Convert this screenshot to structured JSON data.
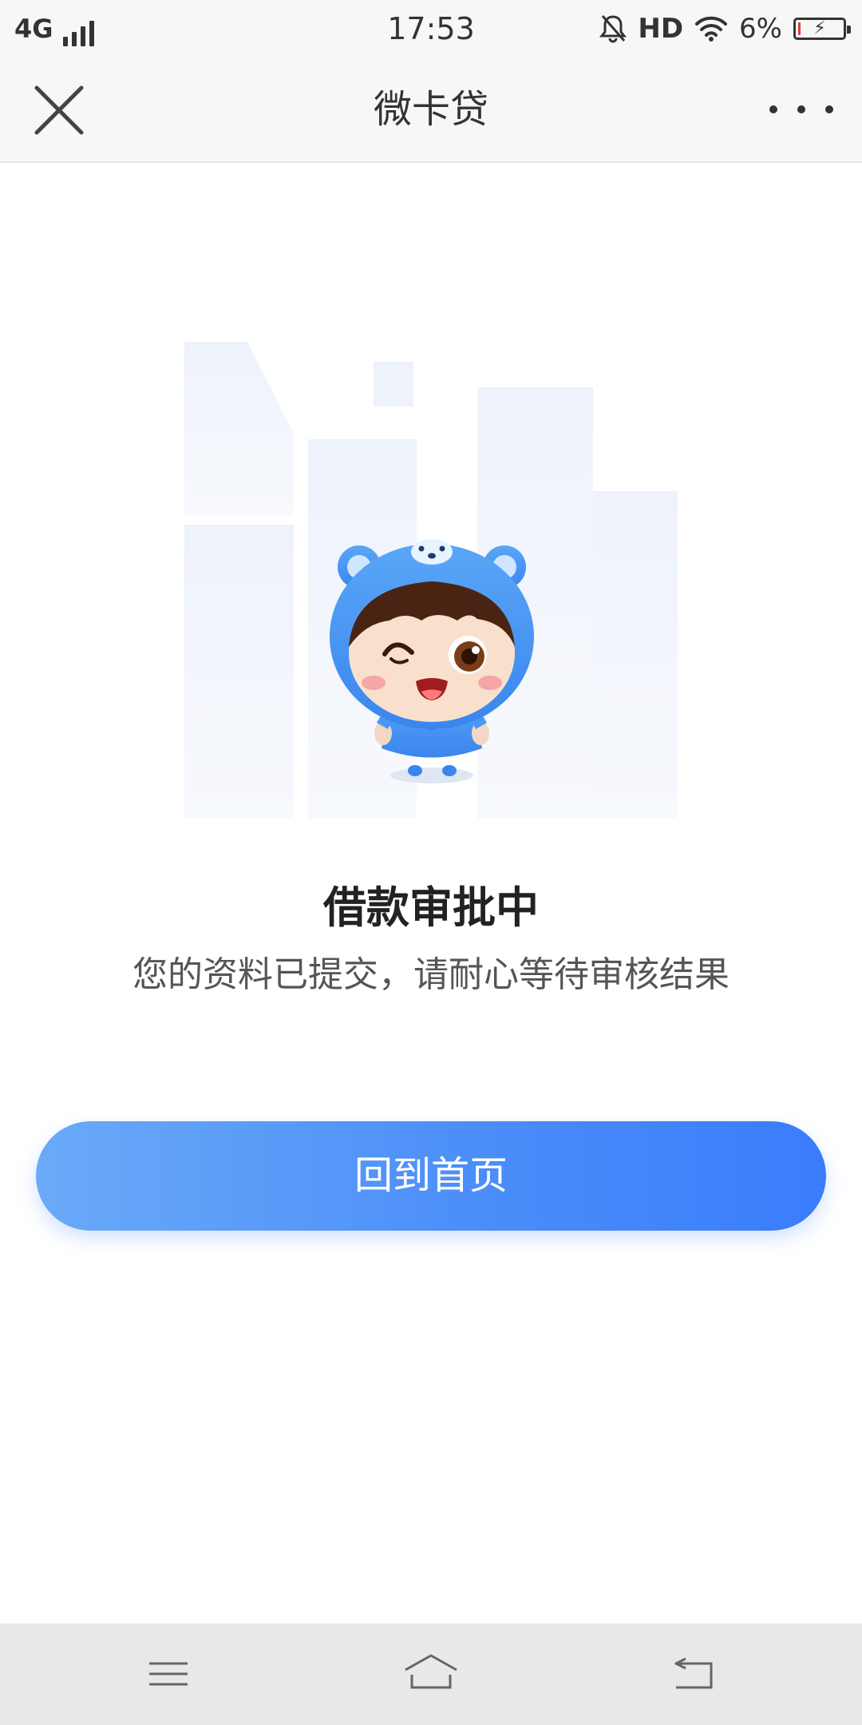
{
  "status_bar": {
    "network": "4G",
    "time": "17:53",
    "hd": "HD",
    "battery_percent": "6%",
    "battery_level": 0.06,
    "icons": [
      "signal-icon",
      "mute-bell-icon",
      "wifi-icon",
      "battery-charging-icon"
    ]
  },
  "nav": {
    "title": "微卡贷",
    "close_icon": "close-icon",
    "more_icon": "more-icon"
  },
  "main": {
    "status_title": "借款审批中",
    "status_message": "您的资料已提交，请耐心等待审核结果",
    "home_button_label": "回到首页"
  },
  "system_nav": {
    "icons": [
      "menu-icon",
      "home-icon",
      "back-icon"
    ]
  },
  "colors": {
    "accent_start": "#6aaaf8",
    "accent_end": "#3a7cfb",
    "mascot_blue": "#3d8ef0"
  }
}
